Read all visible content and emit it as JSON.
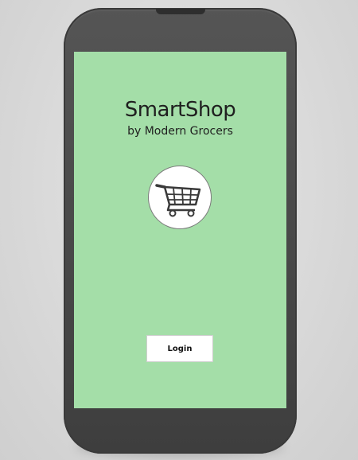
{
  "app": {
    "title": "SmartShop",
    "subtitle": "by Modern Grocers"
  },
  "logo": {
    "icon": "shopping-cart-icon"
  },
  "login": {
    "label": "Login"
  },
  "colors": {
    "screen_background": "#a4dea8",
    "phone_body": "#4a4a4a",
    "button_background": "#ffffff",
    "text": "#1f1f1f"
  }
}
